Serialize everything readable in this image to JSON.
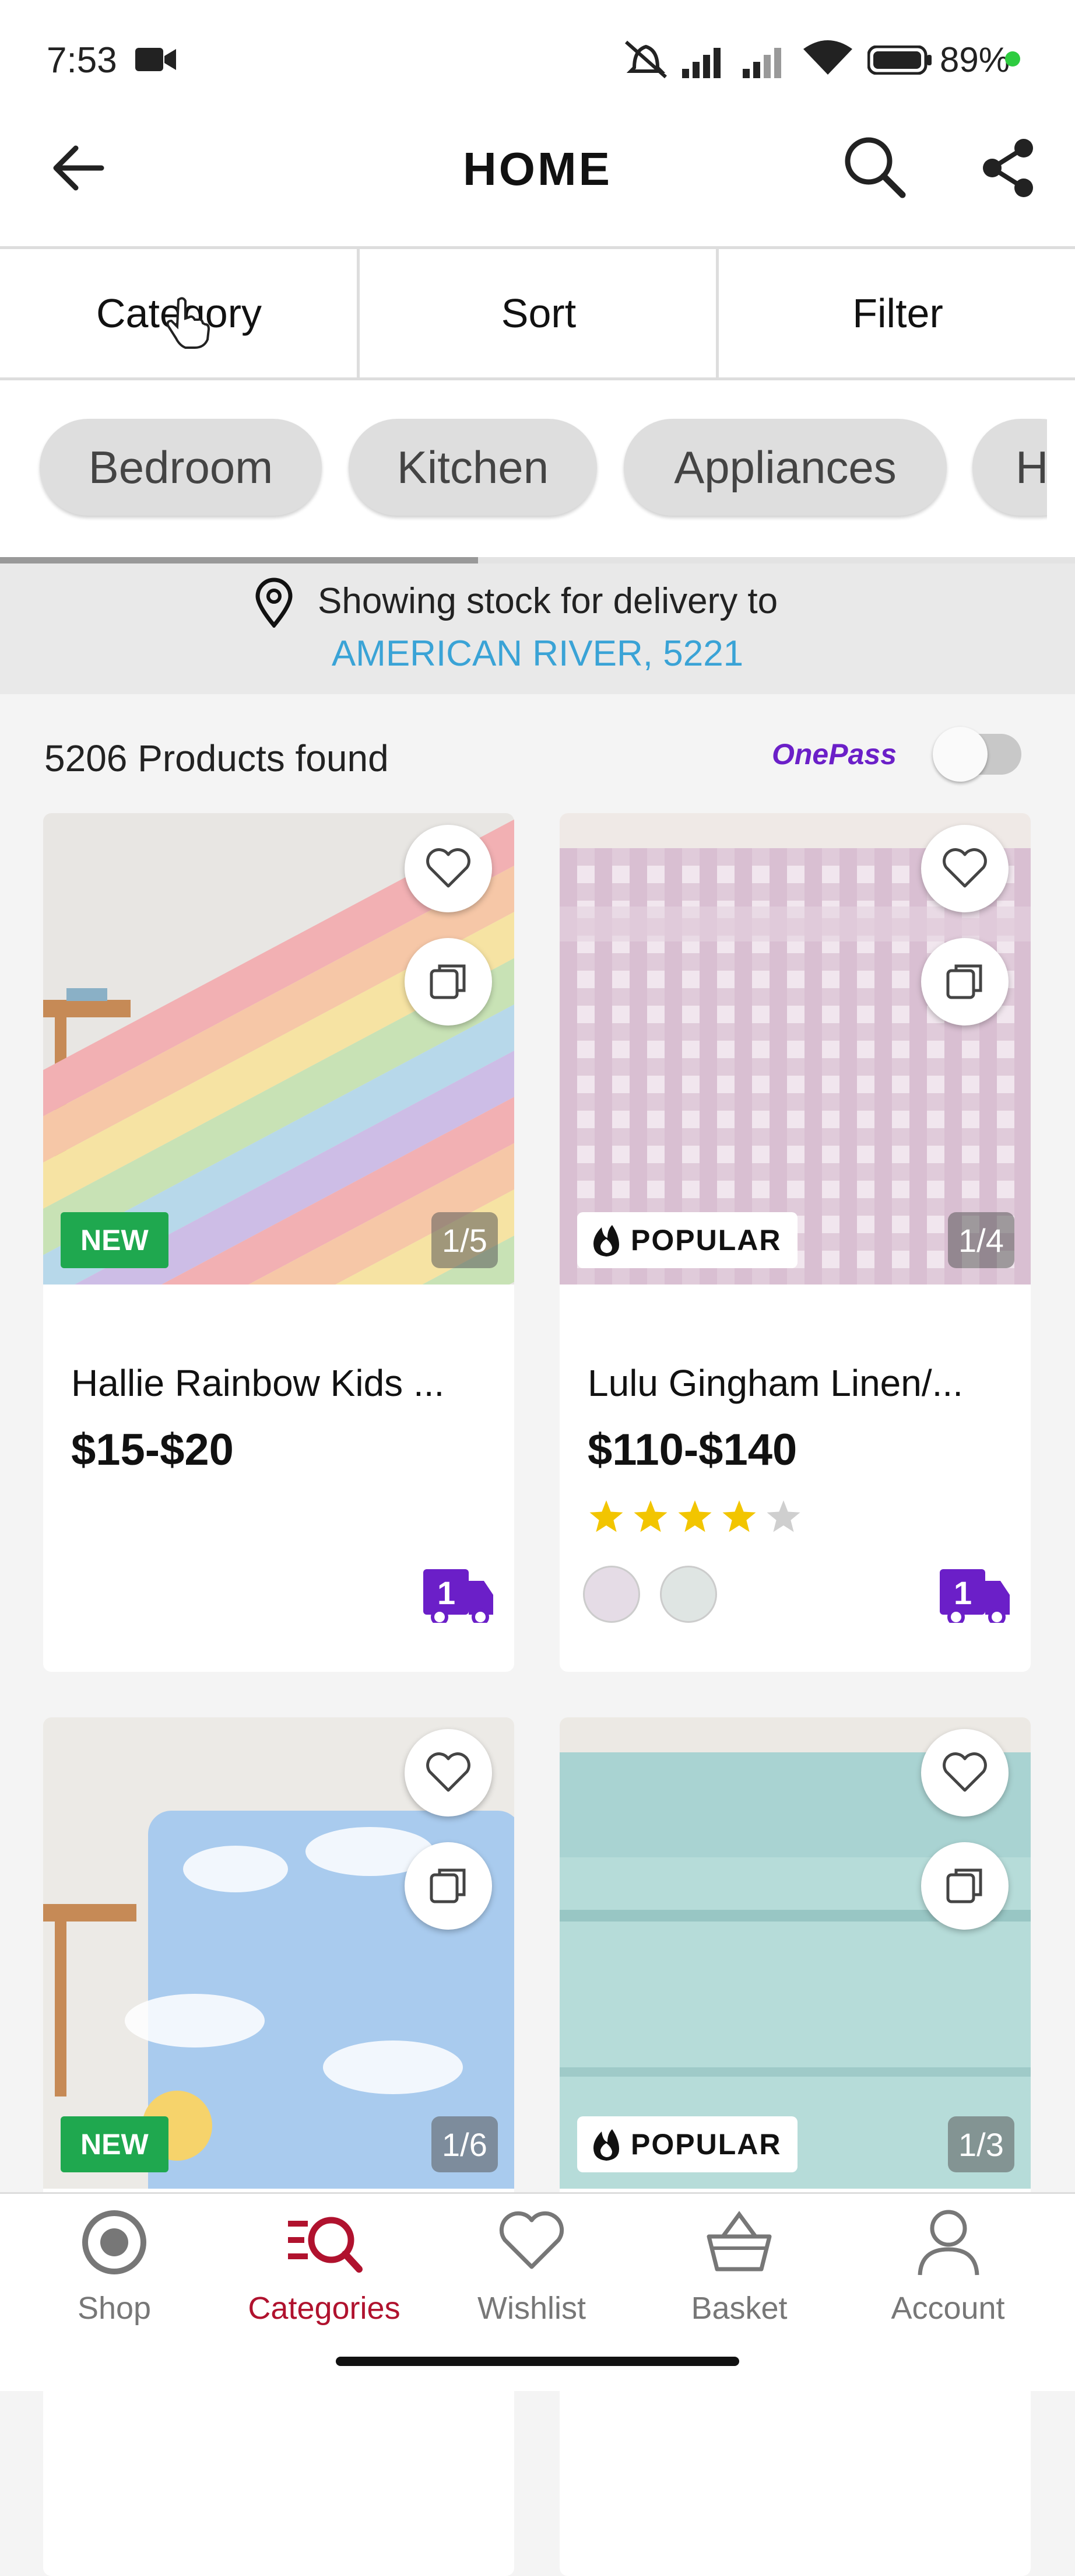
{
  "status_bar": {
    "time": "7:53",
    "battery": "89%"
  },
  "header": {
    "title": "HOME"
  },
  "toolbar": {
    "category": "Category",
    "sort": "Sort",
    "filter": "Filter"
  },
  "chips": [
    "Bedroom",
    "Kitchen",
    "Appliances",
    "H"
  ],
  "delivery": {
    "line1": "Showing stock for delivery to",
    "location": "AMERICAN RIVER, 5221"
  },
  "results": {
    "count_text": "5206 Products found",
    "onepass_label": "OnePass",
    "onepass_enabled": false
  },
  "products": [
    {
      "name": "Hallie Rainbow Kids ...",
      "price": "$15-$20",
      "badge": "NEW",
      "image_counter": "1/5",
      "rating": null,
      "swatch_count": 0
    },
    {
      "name": "Lulu Gingham Linen/...",
      "price": "$110-$140",
      "badge": "POPULAR",
      "image_counter": "1/4",
      "rating": 4,
      "swatch_count": 2
    },
    {
      "badge": "NEW",
      "image_counter": "1/6"
    },
    {
      "badge": "POPULAR",
      "image_counter": "1/3"
    }
  ],
  "bottom_nav": [
    {
      "label": "Shop",
      "icon": "shop-icon",
      "active": false
    },
    {
      "label": "Categories",
      "icon": "categories-icon",
      "active": true
    },
    {
      "label": "Wishlist",
      "icon": "heart-icon",
      "active": false
    },
    {
      "label": "Basket",
      "icon": "basket-icon",
      "active": false
    },
    {
      "label": "Account",
      "icon": "account-icon",
      "active": false
    }
  ],
  "colors": {
    "accent_active": "#b0122e",
    "location_link": "#3aa3d6",
    "onepass": "#6b1fc8",
    "badge_new": "#1fa84f",
    "star": "#f2c500"
  }
}
